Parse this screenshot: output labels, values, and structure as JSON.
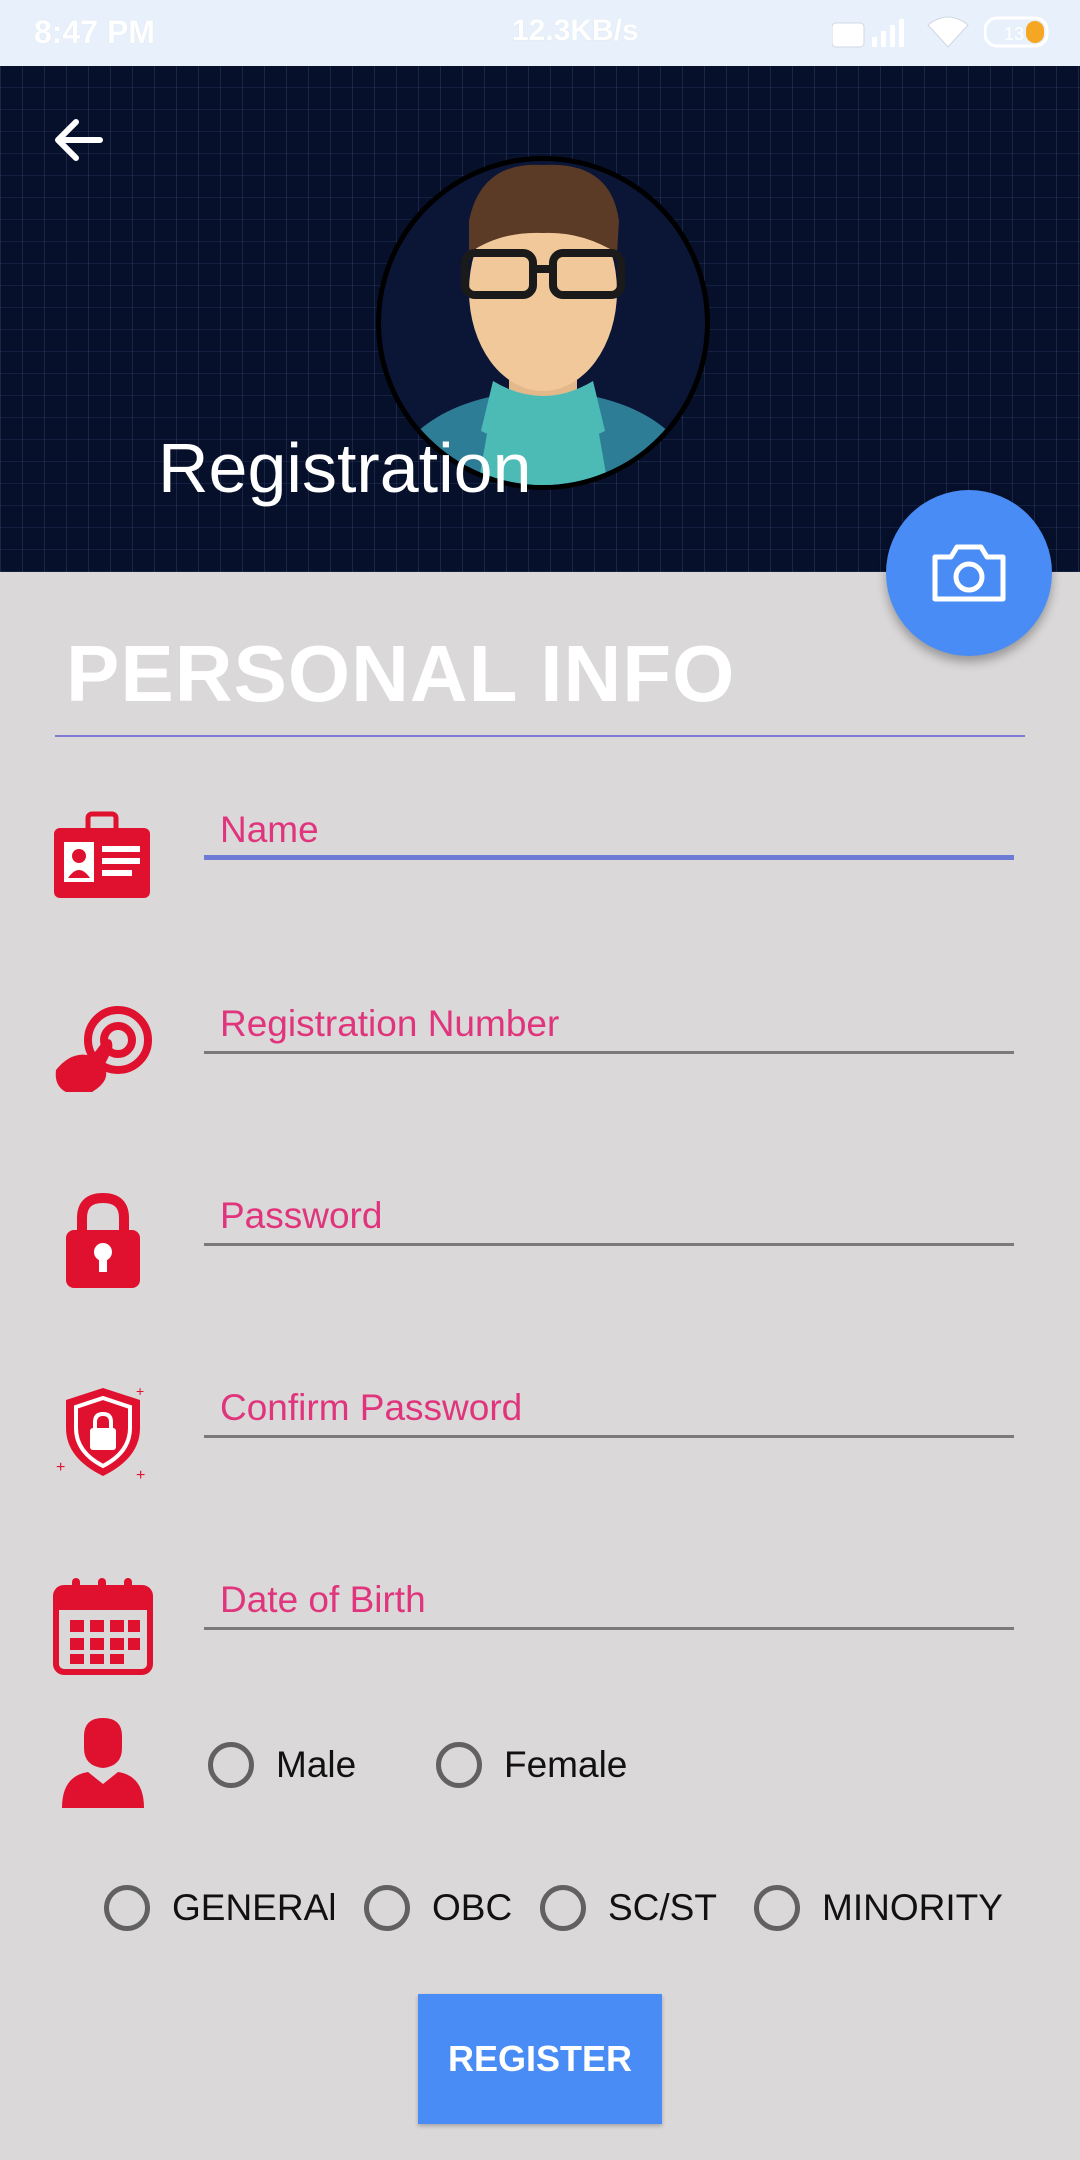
{
  "status_bar": {
    "time": "8:47 PM",
    "network_speed": "12.3KB/s",
    "battery": "13"
  },
  "header": {
    "title": "Registration"
  },
  "section": {
    "title": "PERSONAL INFO"
  },
  "fields": {
    "name": {
      "placeholder": "Name",
      "value": ""
    },
    "registration_number": {
      "placeholder": "Registration Number",
      "value": ""
    },
    "password": {
      "placeholder": "Password",
      "value": ""
    },
    "confirm_password": {
      "placeholder": "Confirm Password",
      "value": ""
    },
    "date_of_birth": {
      "placeholder": "Date of Birth",
      "value": ""
    }
  },
  "gender": {
    "options": [
      "Male",
      "Female"
    ]
  },
  "category": {
    "options": [
      "GENERAl",
      "OBC",
      "SC/ST",
      "MINORITY"
    ]
  },
  "register_button": {
    "label": "REGISTER"
  },
  "colors": {
    "accent": "#4a8cf5",
    "icon_red": "#e0112e",
    "hint_pink": "#e0357c",
    "header_bg": "#06102a"
  }
}
